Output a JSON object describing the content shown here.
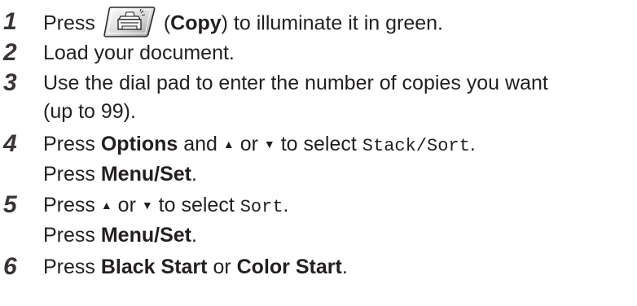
{
  "steps": [
    {
      "number": "1",
      "press": "Press",
      "icon": "copy-key-icon",
      "paren_open": "(",
      "key": "Copy",
      "rest": ") to illuminate it in green."
    },
    {
      "number": "2",
      "text": "Load your document."
    },
    {
      "number": "3",
      "line1": "Use the dial pad to enter the number of copies you want",
      "line2": "(up to 99)."
    },
    {
      "number": "4",
      "press": "Press",
      "key": "Options",
      "and": "and",
      "up": "▲",
      "or": "or",
      "down": "▼",
      "to_select": "to select",
      "lcd": "Stack/Sort",
      "dot": ".",
      "line2_press": "Press",
      "line2_key": "Menu/Set",
      "line2_dot": "."
    },
    {
      "number": "5",
      "press": "Press",
      "up": "▲",
      "or": "or",
      "down": "▼",
      "to_select": "to select",
      "lcd": "Sort",
      "dot": ".",
      "line2_press": "Press",
      "line2_key": "Menu/Set",
      "line2_dot": "."
    },
    {
      "number": "6",
      "press": "Press",
      "key1": "Black Start",
      "or": "or",
      "key2": "Color Start",
      "dot": "."
    }
  ]
}
